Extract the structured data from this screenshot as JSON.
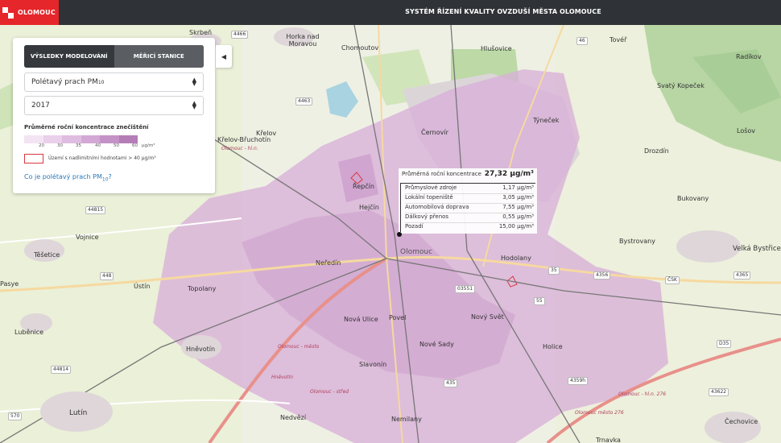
{
  "header": {
    "logo_text": "OLOMOUC",
    "title": "SYSTÉM ŘÍZENÍ KVALITY OVZDUŠÍ MĚSTA OLOMOUCE"
  },
  "panel": {
    "tabs": [
      {
        "label": "VÝSLEDKY MODELOVÁNÍ",
        "active": true
      },
      {
        "label": "MĚŘICÍ STANICE",
        "active": false
      }
    ],
    "pollutant_select": {
      "value_main": "Polétavý prach PM",
      "value_sub": "10"
    },
    "year_select": {
      "value": "2017"
    },
    "legend": {
      "title": "Průměrné roční koncentrace znečištění",
      "ticks": [
        "20",
        "30",
        "35",
        "40",
        "50",
        "60"
      ],
      "unit": "µg/m³",
      "colors": [
        "#f3e4f3",
        "#ead0ea",
        "#dfbde0",
        "#d3a8d5",
        "#c492c6",
        "#b57db7"
      ],
      "exceed_label": "Území s nadlimitními hodnotami  >  40 µg/m³",
      "exceed_color": "#d8383e"
    },
    "info_link": {
      "main": "Co je polétavý prach PM",
      "sub": "10",
      "end": "?"
    }
  },
  "tooltip": {
    "label": "Průměrná roční koncentrace",
    "value": "27,32 µg/m³",
    "rows": [
      {
        "label": "Průmyslové zdroje",
        "value": "1,17 µg/m³"
      },
      {
        "label": "Lokální topeniště",
        "value": "3,05 µg/m³"
      },
      {
        "label": "Automobilová doprava",
        "value": "7,55 µg/m³"
      },
      {
        "label": "Dálkový přenos",
        "value": "0,55 µg/m³"
      },
      {
        "label": "Pozadí",
        "value": "15,00 µg/m³"
      }
    ]
  },
  "map": {
    "colors": {
      "base": "#eef0e4",
      "pollution": "#d9b0d8",
      "urban": "#d8d0d6",
      "motorway": "#e8908a",
      "rail": "#777777"
    },
    "places": [
      {
        "name": "Skrbeň",
        "kind": "town"
      },
      {
        "name": "Horka nad Moravou",
        "kind": "town"
      },
      {
        "name": "Chomoutov",
        "kind": "town"
      },
      {
        "name": "Hlušovice",
        "kind": "town"
      },
      {
        "name": "Tovéř",
        "kind": "town"
      },
      {
        "name": "Radíkov",
        "kind": "town"
      },
      {
        "name": "Svatý Kopeček",
        "kind": "town"
      },
      {
        "name": "Týneček",
        "kind": "town"
      },
      {
        "name": "Lošov",
        "kind": "town"
      },
      {
        "name": "Drozdín",
        "kind": "town"
      },
      {
        "name": "Černovír",
        "kind": "town"
      },
      {
        "name": "Křelov",
        "kind": "town"
      },
      {
        "name": "Křelov-Břuchotín",
        "kind": "town"
      },
      {
        "name": "Řepčín",
        "kind": "town"
      },
      {
        "name": "Hejčín",
        "kind": "town"
      },
      {
        "name": "Bukovany",
        "kind": "town"
      },
      {
        "name": "Vojnice",
        "kind": "town"
      },
      {
        "name": "Bystrovany",
        "kind": "town"
      },
      {
        "name": "Velká Bystřice",
        "kind": "town"
      },
      {
        "name": "Těšetice",
        "kind": "town"
      },
      {
        "name": "Neředín",
        "kind": "town"
      },
      {
        "name": "Olomouc",
        "kind": "city"
      },
      {
        "name": "Hodolany",
        "kind": "town"
      },
      {
        "name": "Topolany",
        "kind": "town"
      },
      {
        "name": "Ústín",
        "kind": "town"
      },
      {
        "name": "Luběnice",
        "kind": "town"
      },
      {
        "name": "Nová Ulice",
        "kind": "town"
      },
      {
        "name": "Povel",
        "kind": "town"
      },
      {
        "name": "Nový Svět",
        "kind": "town"
      },
      {
        "name": "Nové Sady",
        "kind": "town"
      },
      {
        "name": "Holice",
        "kind": "town"
      },
      {
        "name": "Hněvotín",
        "kind": "town"
      },
      {
        "name": "Slavonín",
        "kind": "town"
      },
      {
        "name": "Lutín",
        "kind": "town"
      },
      {
        "name": "Nedvězí",
        "kind": "town"
      },
      {
        "name": "Nemilany",
        "kind": "town"
      },
      {
        "name": "Čechovice",
        "kind": "town"
      },
      {
        "name": "Pasye",
        "kind": "town"
      },
      {
        "name": "Trnavka",
        "kind": "town"
      }
    ],
    "roads": [
      "4466",
      "4463",
      "46",
      "44815",
      "448",
      "35",
      "4356",
      "ČSK",
      "4365",
      "03551",
      "55",
      "D35",
      "44814",
      "435",
      "4359h",
      "570",
      "43622"
    ],
    "rail_labels": [
      "Olomouc - hl.n.",
      "Olomouc - město",
      "Hněvotín",
      "Olomouc - hl.n. 276",
      "Olomouc město 276",
      "Olomouc - střed"
    ]
  }
}
